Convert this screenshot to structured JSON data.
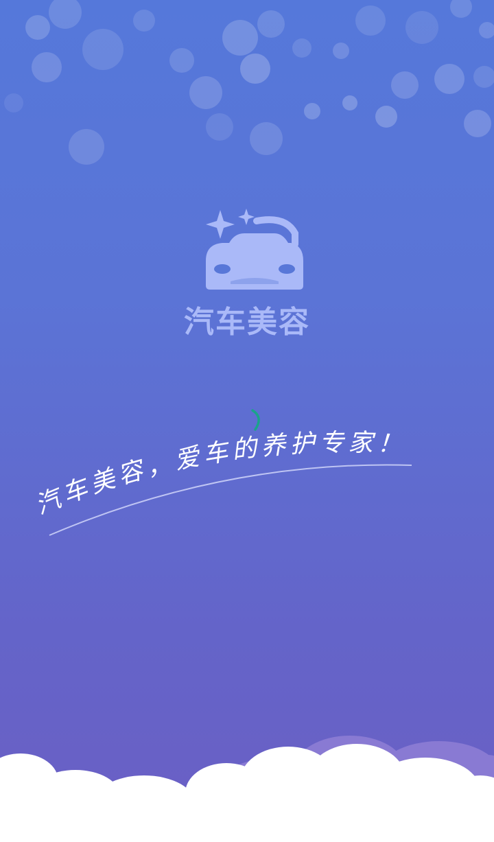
{
  "app": {
    "name": "汽车美容"
  },
  "slogan": {
    "text": "汽车美容，爱车的养护专家！"
  },
  "icons": {
    "logo": "car-with-sparkles-icon",
    "loader": "loading-spinner-icon"
  },
  "colors": {
    "background_top": "#5578da",
    "background_bottom": "#6b5fc4",
    "logo": "#aab9f8",
    "slogan": "#ffffff",
    "spinner": "#1aa38a",
    "cloud": "#ffffff"
  }
}
